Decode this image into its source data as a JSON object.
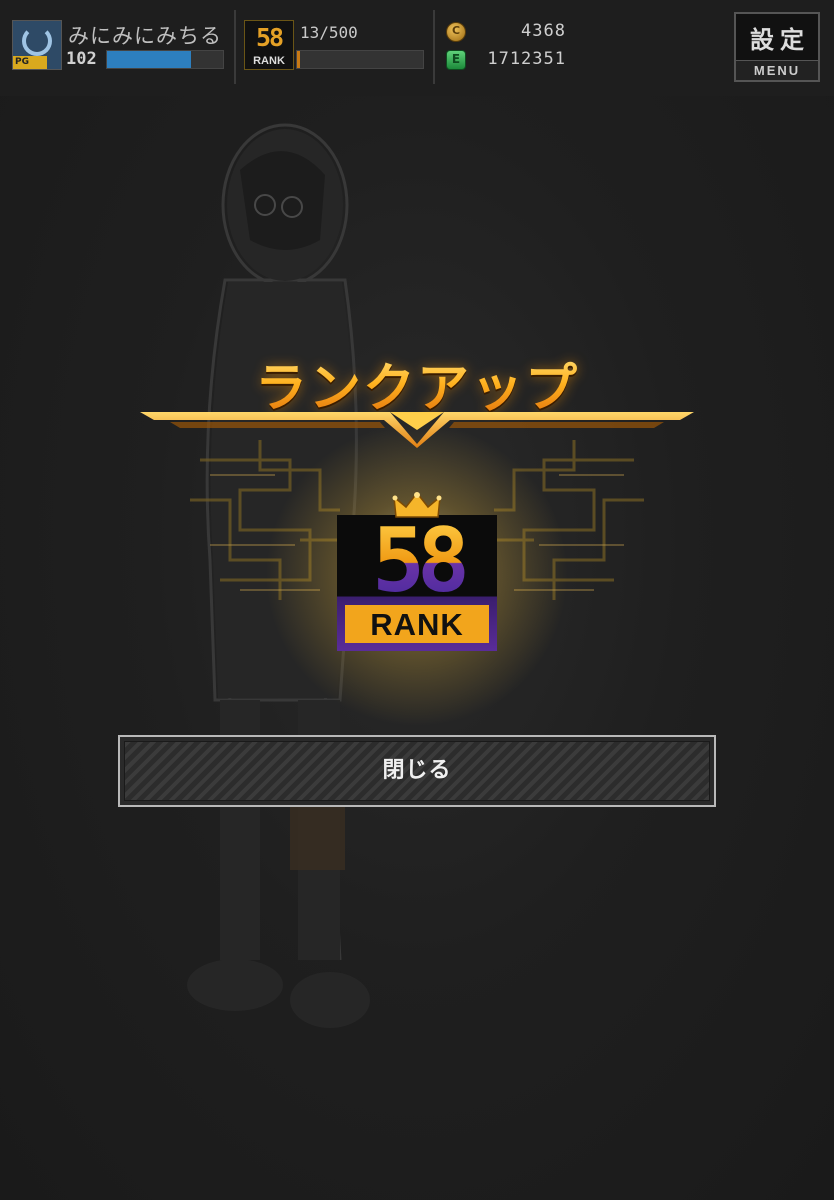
{
  "header": {
    "player_name": "みにみにみちる",
    "player_level": "102",
    "exp_progress": 0.72,
    "avatar_tag": "PG",
    "rank_icon_number": "58",
    "rank_icon_label": "RANK",
    "rank_progress": "13/500",
    "rank_progress_fraction": 0.026,
    "coins": "4368",
    "berries": "1712351",
    "settings_label": "設定",
    "menu_label": "MENU"
  },
  "modal": {
    "title": "ランクアップ",
    "rank_number": "58",
    "rank_label": "RANK",
    "close_label": "閉じる"
  },
  "colors": {
    "accent_gold": "#f2a51c",
    "accent_orange": "#e06d0b",
    "exp_bar": "#2d7fbf",
    "rank_purple": "#5a2c99"
  }
}
